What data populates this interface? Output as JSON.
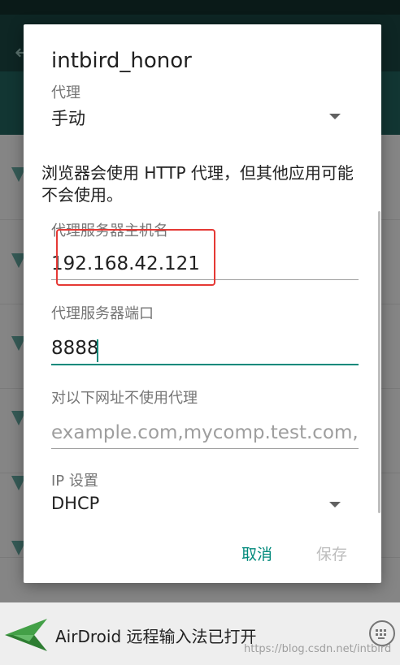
{
  "dialog": {
    "title": "intbird_honor",
    "proxy": {
      "label": "代理",
      "value": "手动"
    },
    "info": "浏览器会使用 HTTP 代理，但其他应用可能不会使用。",
    "hostname": {
      "label": "代理服务器主机名",
      "value": "192.168.42.121"
    },
    "port": {
      "label": "代理服务器端口",
      "value": "8888"
    },
    "bypass": {
      "label": "对以下网址不使用代理",
      "placeholder": "example.com,mycomp.test.com,localhost"
    },
    "ip_settings": {
      "label": "IP 设置",
      "value": "DHCP"
    },
    "buttons": {
      "cancel": "取消",
      "save": "保存"
    }
  },
  "notification": {
    "text": "AirDroid 远程输入法已打开",
    "watermark": "https://blog.csdn.net/intbird"
  },
  "icons": {
    "back": "back-arrow-icon",
    "dropdown": "dropdown-arrow-icon",
    "logo": "airdroid-logo-icon",
    "keyboard": "keyboard-icon"
  },
  "colors": {
    "accent": "#00897b",
    "highlight": "#e53935",
    "disabled": "#bdbdbd"
  }
}
